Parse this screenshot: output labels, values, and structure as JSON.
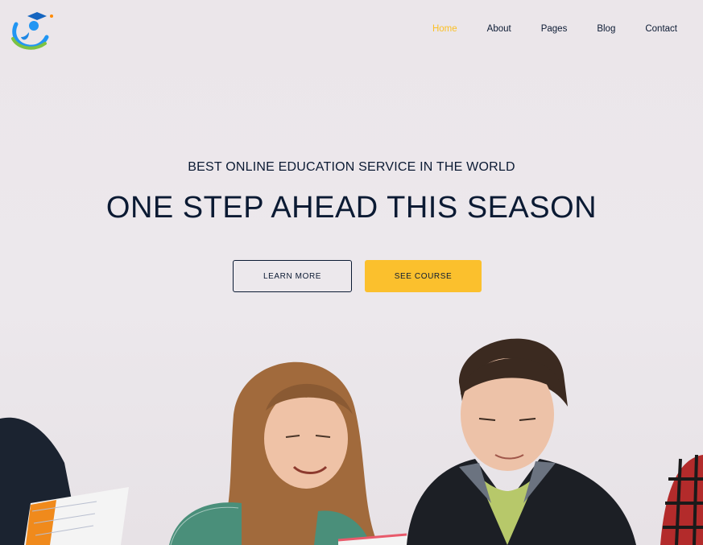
{
  "nav": {
    "items": [
      {
        "label": "Home",
        "active": true
      },
      {
        "label": "About",
        "active": false
      },
      {
        "label": "Pages",
        "active": false
      },
      {
        "label": "Blog",
        "active": false
      },
      {
        "label": "Contact",
        "active": false
      }
    ]
  },
  "hero": {
    "subtitle": "BEST ONLINE EDUCATION SERVICE IN THE WORLD",
    "title": "ONE STEP AHEAD THIS SEASON",
    "learn_more_label": "LEARN MORE",
    "see_course_label": "SEE COURSE"
  },
  "colors": {
    "accent": "#fbc02d",
    "nav_active": "#fbbf24",
    "text_dark": "#0b1a33",
    "background": "#ebe6ea"
  },
  "icons": {
    "logo": "graduate-logo-icon"
  }
}
